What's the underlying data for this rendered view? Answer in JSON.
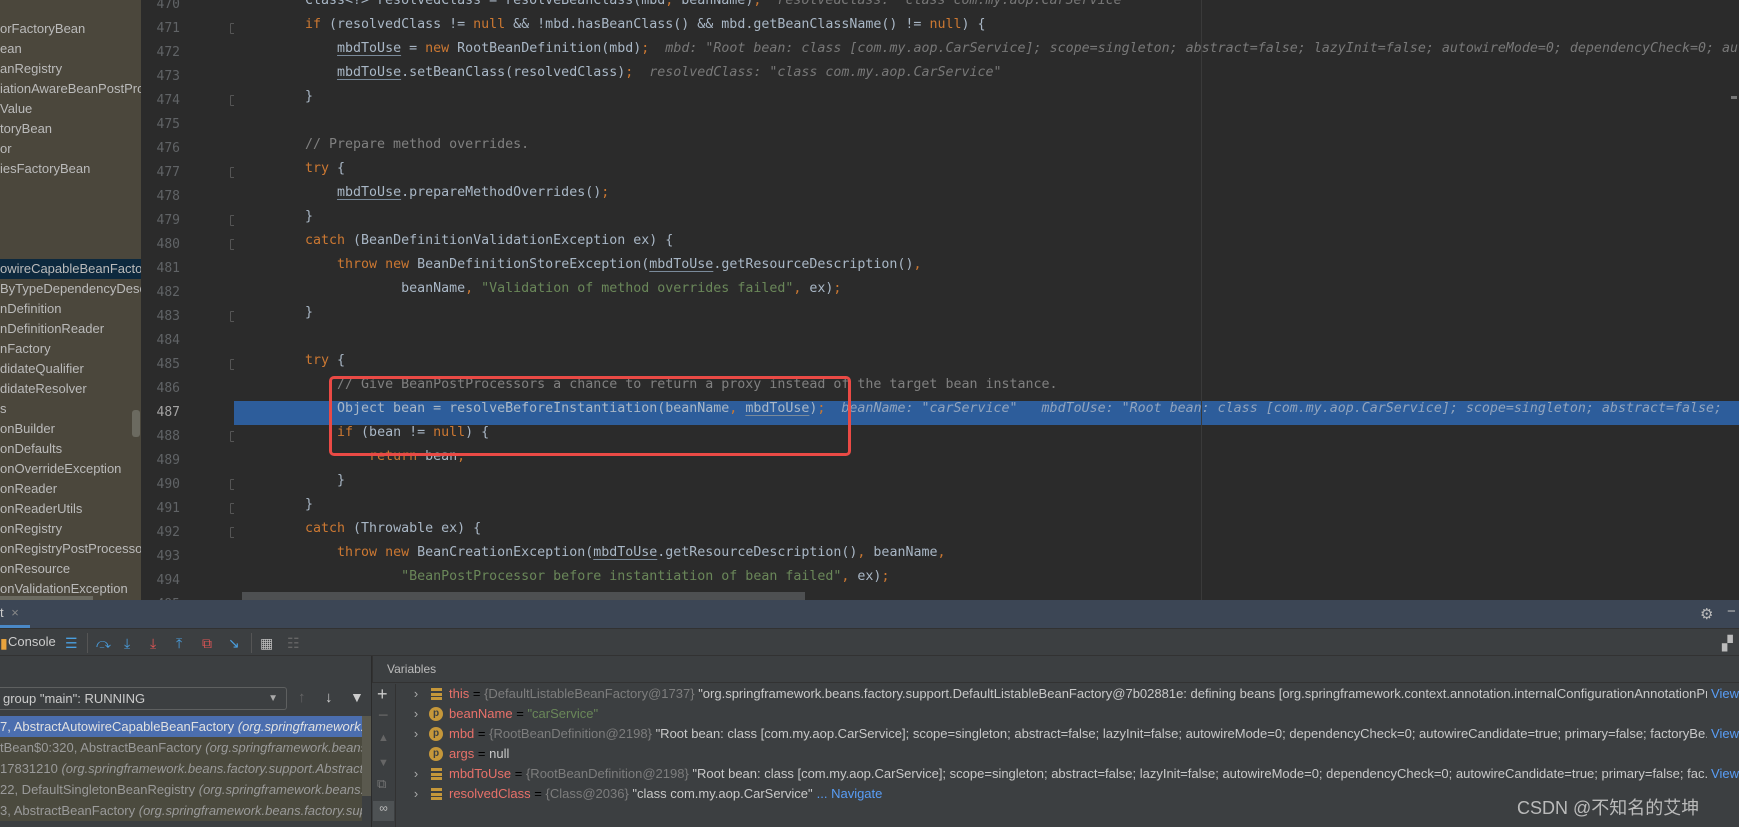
{
  "project_tree": {
    "items": [
      "orFactoryBean",
      "ean",
      "anRegistry",
      "iationAwareBeanPostPro",
      "Value",
      "toryBean",
      "or",
      "iesFactoryBean",
      "",
      "",
      "",
      "",
      "owireCapableBeanFactory",
      "ByTypeDependencyDescr",
      "nDefinition",
      "nDefinitionReader",
      "nFactory",
      "didateQualifier",
      "didateResolver",
      "s",
      "onBuilder",
      "onDefaults",
      "onOverrideException",
      "onReader",
      "onReaderUtils",
      "onRegistry",
      "onRegistryPostProcessor",
      "onResource",
      "onValidationException"
    ],
    "selected_index": 12
  },
  "editor": {
    "first_line": 470,
    "current_line": 487,
    "fold_lines": [
      471,
      474,
      477,
      479,
      480,
      483,
      485,
      488,
      490,
      491,
      492
    ],
    "lines": [
      [
        [
          "p",
          "Class<?> resolvedClass = resolveBeanClass(mbd"
        ],
        [
          "kw",
          ","
        ],
        [
          "p",
          " beanName)"
        ],
        [
          "kw",
          ";"
        ],
        [
          "hint",
          "  resolvedClass: \"class com.my.aop.CarService\""
        ]
      ],
      [
        [
          "kw",
          "if"
        ],
        [
          "p",
          " (resolvedClass != "
        ],
        [
          "kw",
          "null"
        ],
        [
          "p",
          " && !mbd.hasBeanClass() && mbd.getBeanClassName() != "
        ],
        [
          "kw",
          "null"
        ],
        [
          "p",
          ") {"
        ]
      ],
      [
        [
          "p",
          "    "
        ],
        [
          "var",
          "mbdToUse"
        ],
        [
          "p",
          " = "
        ],
        [
          "kw",
          "new"
        ],
        [
          "p",
          " RootBeanDefinition(mbd)"
        ],
        [
          "kw",
          ";"
        ],
        [
          "hint",
          "  mbd: \"Root bean: class [com.my.aop.CarService]; scope=singleton; abstract=false; lazyInit=false; autowireMode=0; dependencyCheck=0; au"
        ]
      ],
      [
        [
          "p",
          "    "
        ],
        [
          "var",
          "mbdToUse"
        ],
        [
          "p",
          ".setBeanClass(resolvedClass)"
        ],
        [
          "kw",
          ";"
        ],
        [
          "hint",
          "  resolvedClass: \"class com.my.aop.CarService\""
        ]
      ],
      [
        [
          "p",
          "}"
        ]
      ],
      [],
      [
        [
          "cmt",
          "// Prepare method overrides."
        ]
      ],
      [
        [
          "kw",
          "try"
        ],
        [
          "p",
          " {"
        ]
      ],
      [
        [
          "p",
          "    "
        ],
        [
          "var",
          "mbdToUse"
        ],
        [
          "p",
          ".prepareMethodOverrides()"
        ],
        [
          "kw",
          ";"
        ]
      ],
      [
        [
          "p",
          "}"
        ]
      ],
      [
        [
          "kw",
          "catch"
        ],
        [
          "p",
          " (BeanDefinitionValidationException ex) {"
        ]
      ],
      [
        [
          "p",
          "    "
        ],
        [
          "kw",
          "throw new"
        ],
        [
          "p",
          " BeanDefinitionStoreException("
        ],
        [
          "var",
          "mbdToUse"
        ],
        [
          "p",
          ".getResourceDescription()"
        ],
        [
          "kw",
          ","
        ]
      ],
      [
        [
          "p",
          "            beanName"
        ],
        [
          "kw",
          ","
        ],
        [
          "p",
          " "
        ],
        [
          "str",
          "\"Validation of method overrides failed\""
        ],
        [
          "kw",
          ","
        ],
        [
          "p",
          " ex)"
        ],
        [
          "kw",
          ";"
        ]
      ],
      [
        [
          "p",
          "}"
        ]
      ],
      [],
      [
        [
          "kw",
          "try"
        ],
        [
          "p",
          " {"
        ]
      ],
      [
        [
          "p",
          "    "
        ],
        [
          "cmt",
          "// Give BeanPostProcessors a chance to return a proxy instead of the target bean instance."
        ]
      ],
      [
        [
          "p",
          "    Object bean = resolveBeforeInstantiation(beanName"
        ],
        [
          "kw",
          ","
        ],
        [
          "p",
          " "
        ],
        [
          "var",
          "mbdToUse"
        ],
        [
          "p",
          ")"
        ],
        [
          "kw",
          ";"
        ],
        [
          "hint",
          "  beanName: \"carService\"   mbdToUse: \"Root bean: class [com.my.aop.CarService]; scope=singleton; abstract=false;"
        ]
      ],
      [
        [
          "p",
          "    "
        ],
        [
          "kw",
          "if"
        ],
        [
          "p",
          " (bean != "
        ],
        [
          "kw",
          "null"
        ],
        [
          "p",
          ") {"
        ]
      ],
      [
        [
          "p",
          "        "
        ],
        [
          "kw",
          "return"
        ],
        [
          "p",
          " bean"
        ],
        [
          "kw",
          ";"
        ]
      ],
      [
        [
          "p",
          "    }"
        ]
      ],
      [
        [
          "p",
          "}"
        ]
      ],
      [
        [
          "kw",
          "catch"
        ],
        [
          "p",
          " (Throwable ex) {"
        ]
      ],
      [
        [
          "p",
          "    "
        ],
        [
          "kw",
          "throw new"
        ],
        [
          "p",
          " BeanCreationException("
        ],
        [
          "var",
          "mbdToUse"
        ],
        [
          "p",
          ".getResourceDescription()"
        ],
        [
          "kw",
          ","
        ],
        [
          "p",
          " beanName"
        ],
        [
          "kw",
          ","
        ]
      ],
      [
        [
          "p",
          "            "
        ],
        [
          "str",
          "\"BeanPostProcessor before instantiation of bean failed\""
        ],
        [
          "kw",
          ","
        ],
        [
          "p",
          " ex)"
        ],
        [
          "kw",
          ";"
        ]
      ],
      [
        [
          "p",
          "}"
        ]
      ]
    ]
  },
  "debug": {
    "tab_label": "t",
    "console_label": "Console",
    "thread_selector": "group \"main\": RUNNING",
    "variables_title": "Variables",
    "frames": [
      {
        "method": "7, AbstractAutowireCapableBeanFactory ",
        "pkg": "(org.springframework.b"
      },
      {
        "method": "tBean$0:320, AbstractBeanFactory ",
        "pkg": "(org.springframework.beans.f"
      },
      {
        "method": "17831210 ",
        "pkg": "(org.springframework.beans.factory.support.Abstract"
      },
      {
        "method": "22, DefaultSingletonBeanRegistry ",
        "pkg": "(org.springframework.beans.fa"
      },
      {
        "method": "3, AbstractBeanFactory ",
        "pkg": "(org.springframework.beans.factory.supp"
      }
    ],
    "selected_frame": 0,
    "variables": [
      {
        "icon": "field",
        "expandable": true,
        "name": "this",
        "type": "{DefaultListableBeanFactory@1737}",
        "value": "\"org.springframework.beans.factory.support.DefaultListableBeanFactory@7b02881e: defining beans [org.springframework.context.annotation.internalConfigurationAnnotationPr...",
        "link": "View"
      },
      {
        "icon": "param",
        "expandable": true,
        "name": "beanName",
        "type": "",
        "string_value": "\"carService\""
      },
      {
        "icon": "param",
        "expandable": true,
        "name": "mbd",
        "type": "{RootBeanDefinition@2198}",
        "value": "\"Root bean: class [com.my.aop.CarService]; scope=singleton; abstract=false; lazyInit=false; autowireMode=0; dependencyCheck=0; autowireCandidate=true; primary=false; factoryBe...",
        "link": "View"
      },
      {
        "icon": "param",
        "expandable": false,
        "name": "args",
        "type": "",
        "value": "null"
      },
      {
        "icon": "field",
        "expandable": true,
        "name": "mbdToUse",
        "type": "{RootBeanDefinition@2198}",
        "value": "\"Root bean: class [com.my.aop.CarService]; scope=singleton; abstract=false; lazyInit=false; autowireMode=0; dependencyCheck=0; autowireCandidate=true; primary=false; fac...",
        "link": "View"
      },
      {
        "icon": "field",
        "expandable": true,
        "name": "resolvedClass",
        "type": "{Class@2036}",
        "value": "\"class com.my.aop.CarService\"",
        "link": "... Navigate"
      }
    ]
  },
  "watermark": "CSDN @不知名的艾坤",
  "colors": {
    "highlight": "#2d5d9b",
    "annotation_box": "#ea4a45",
    "selected_frame": "#4b6eaf",
    "keyword": "#cc7832",
    "string": "#6a8759"
  }
}
